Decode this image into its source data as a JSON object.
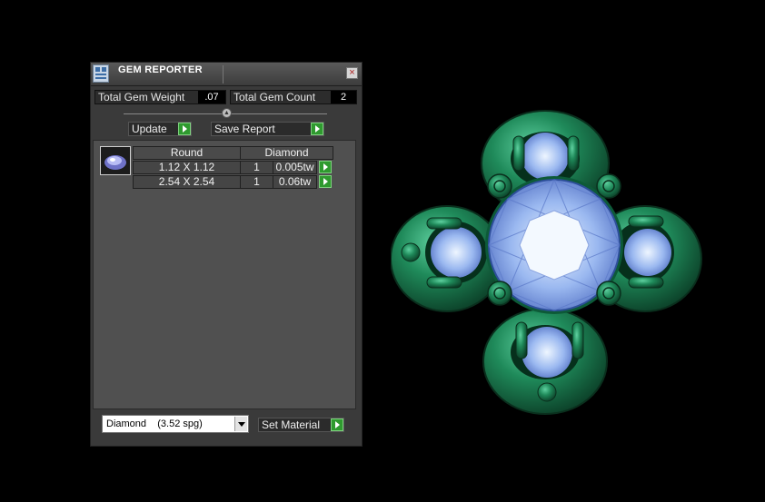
{
  "panel": {
    "title": "GEM REPORTER",
    "close_label": "×",
    "total_weight_label": "Total Gem Weight",
    "total_weight_value": ".07",
    "total_count_label": "Total Gem Count",
    "total_count_value": "2",
    "update_label": "Update",
    "save_report_label": "Save Report",
    "table": {
      "headers": [
        "Round",
        "Diamond"
      ],
      "rows": [
        {
          "size": "1.12 X 1.12",
          "qty": "1",
          "weight": "0.005tw"
        },
        {
          "size": "2.54 X 2.54",
          "qty": "1",
          "weight": "0.06tw"
        }
      ]
    },
    "material_select": "Diamond    (3.52 spg)",
    "set_material_label": "Set Material"
  },
  "colors": {
    "metal": "#1f8a5a",
    "gem": "#9ab8f0",
    "go_button": "#2f9a2f"
  },
  "icons": {
    "app": "gem-reporter-app-icon",
    "close": "close-icon",
    "go": "green-arrow-icon",
    "dropdown": "chevron-down-icon"
  }
}
